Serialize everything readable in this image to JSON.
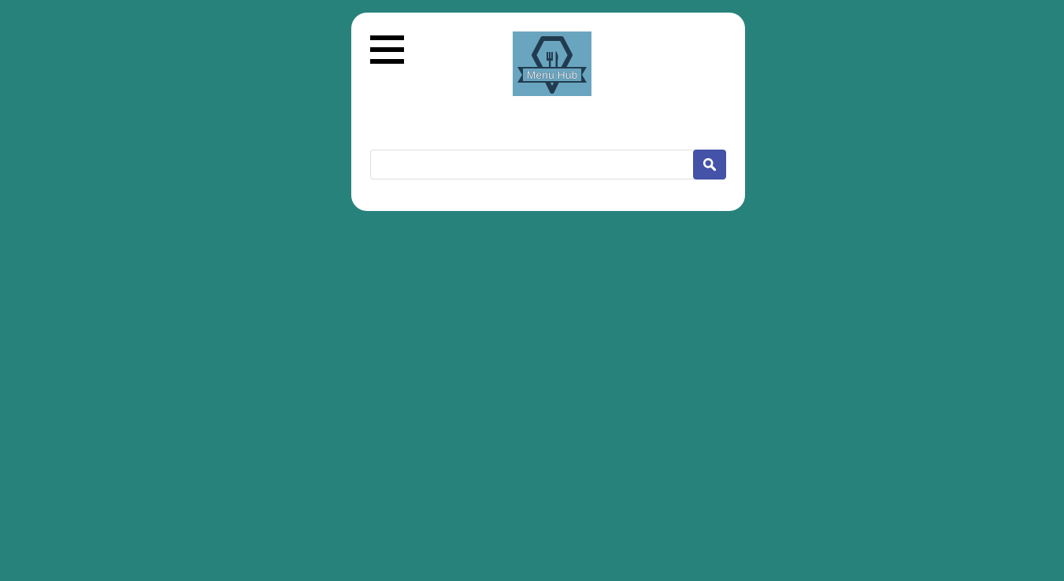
{
  "header": {
    "menu_icon": "hamburger-menu-icon",
    "logo": {
      "text": "Menu Hub",
      "icon": "fork-knife-hexagon-logo",
      "background_color": "#6aa5c0",
      "ink_color": "#213b4e"
    }
  },
  "search": {
    "value": "",
    "placeholder": "",
    "button_icon": "search-icon",
    "button_color": "#4453a8"
  },
  "colors": {
    "page_background": "#27827c",
    "card_background": "#ffffff"
  }
}
